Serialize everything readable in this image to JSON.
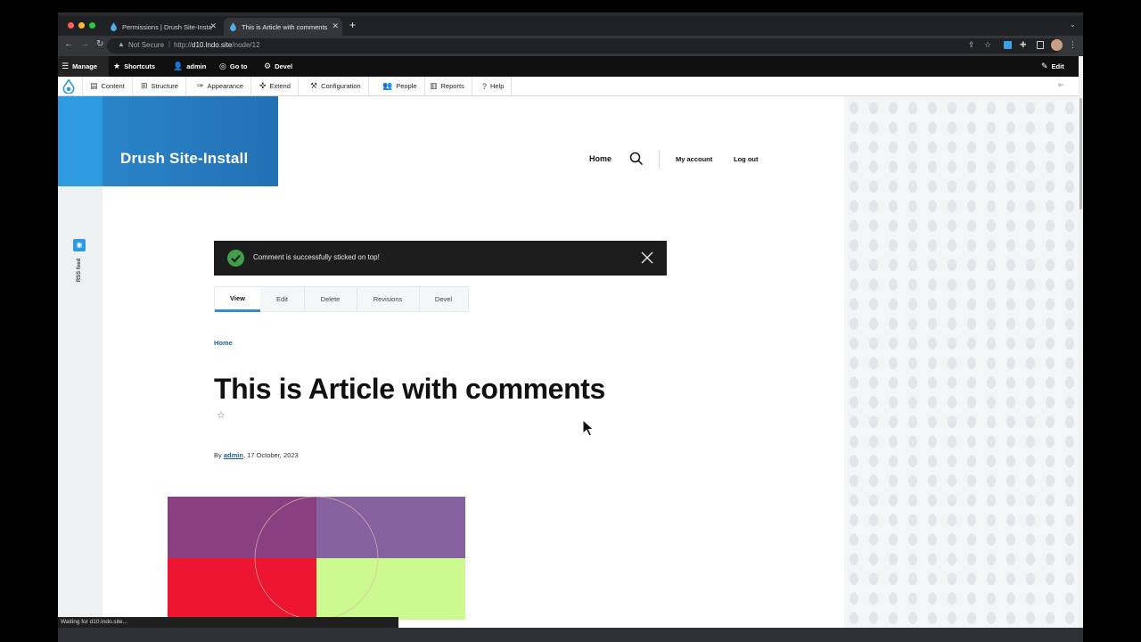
{
  "browser": {
    "tabs": [
      {
        "title": "Permissions | Drush Site-Insta"
      },
      {
        "title": "This is Article with comments"
      }
    ],
    "new_tab": "+",
    "security": "Not Secure",
    "url_prefix": "http://",
    "url_host": "d10.lndo.site",
    "url_path": "/node/12",
    "status_text": "Waiting for d10.lndo.site..."
  },
  "toolbar": {
    "manage": "Manage",
    "shortcuts": "Shortcuts",
    "user": "admin",
    "goto": "Go to",
    "devel": "Devel",
    "edit": "Edit"
  },
  "tray": {
    "items": [
      "Content",
      "Structure",
      "Appearance",
      "Extend",
      "Configuration",
      "People",
      "Reports",
      "Help"
    ]
  },
  "site": {
    "name": "Drush Site-Install",
    "nav_home": "Home",
    "nav_account": "My account",
    "nav_logout": "Log out",
    "rss": "RSS feed"
  },
  "message": {
    "text": "Comment is successfully sticked on top!"
  },
  "local_tasks": [
    "View",
    "Edit",
    "Delete",
    "Revisions",
    "Devel"
  ],
  "breadcrumb": "Home",
  "article": {
    "title": "This is Article with comments",
    "by": "By",
    "author": "admin",
    "date": ", 17 October, 2023"
  },
  "colors": {
    "drupal_blue": "#2270b3",
    "hero_purple": "#8a3f80",
    "hero_lavender": "#86619f",
    "hero_red": "#ed1530",
    "hero_lime": "#ccfa90"
  }
}
